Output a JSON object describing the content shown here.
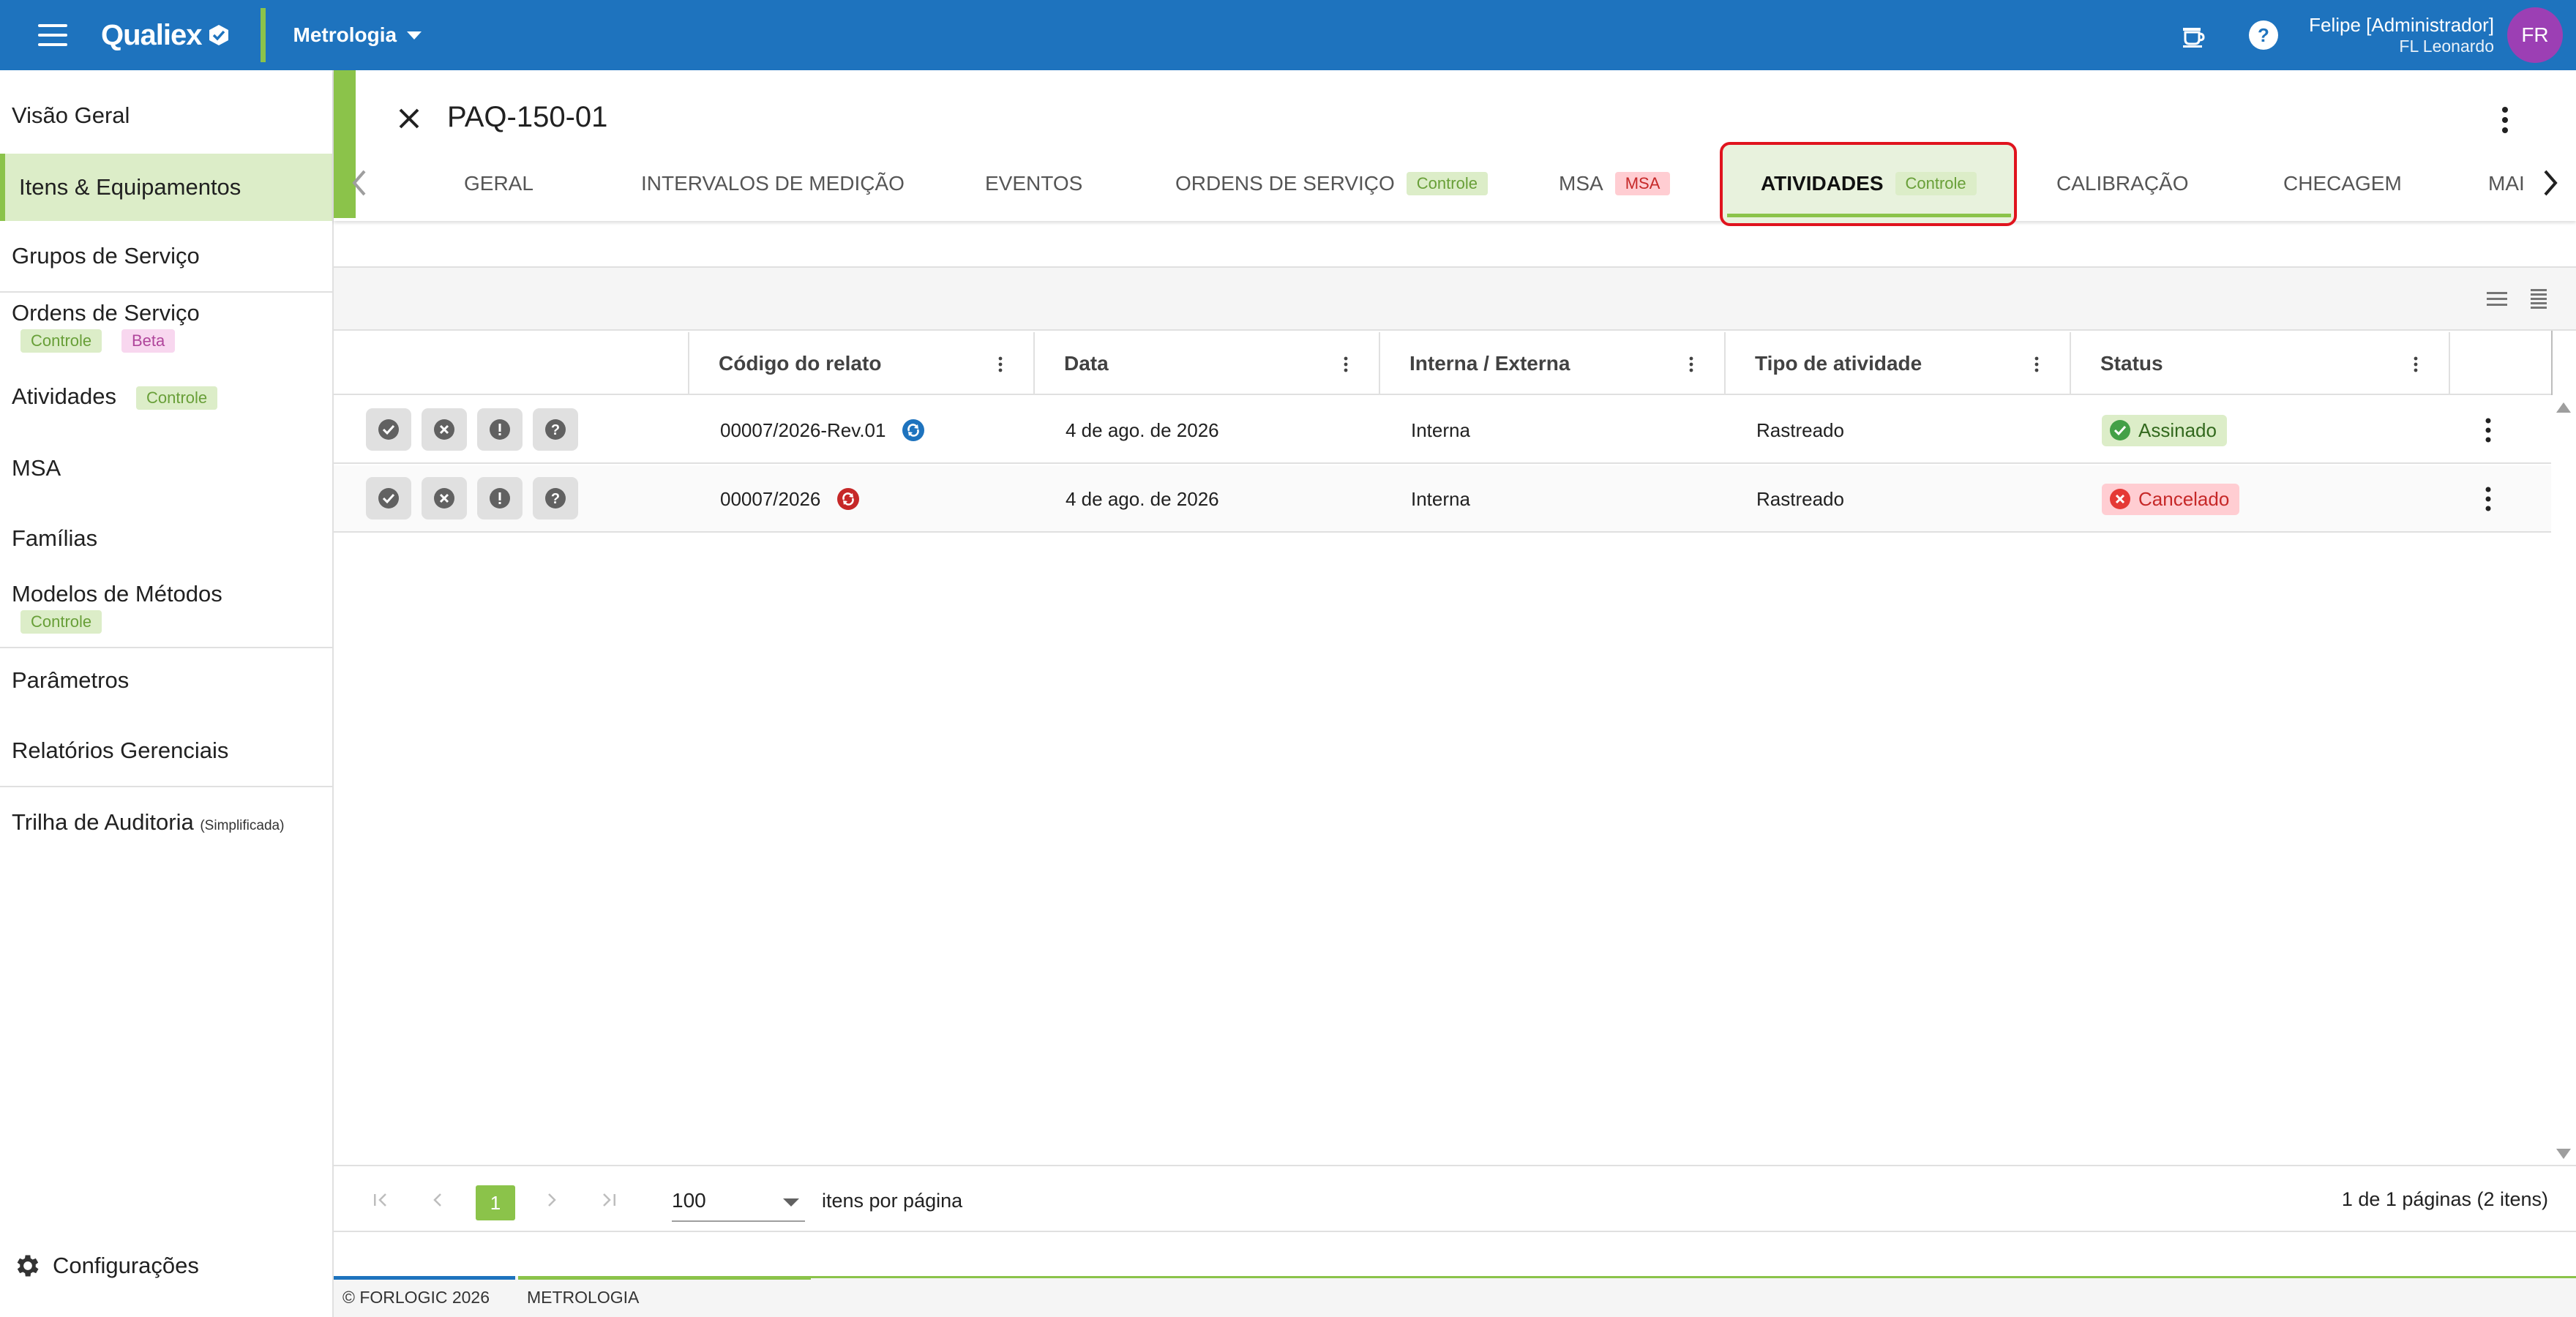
{
  "topbar": {
    "logo": "Qualiex",
    "module": "Metrologia",
    "user_name": "Felipe [Administrador]",
    "user_company": "FL Leonardo",
    "avatar_initials": "FR",
    "color": "#1e73be"
  },
  "sidebar": {
    "items": [
      {
        "label": "Visão Geral"
      },
      {
        "label": "Itens & Equipamentos",
        "active": true
      },
      {
        "label": "Grupos de Serviço"
      },
      {
        "label": "Ordens de Serviço",
        "chips": [
          "Controle",
          "Beta"
        ]
      },
      {
        "label": "Atividades",
        "chips": [
          "Controle"
        ]
      },
      {
        "label": "MSA"
      },
      {
        "label": "Famílias"
      },
      {
        "label": "Modelos de Métodos",
        "chips": [
          "Controle"
        ]
      },
      {
        "label": "Parâmetros"
      },
      {
        "label": "Relatórios Gerenciais"
      },
      {
        "label": "Trilha de Auditoria",
        "suffix": "(Simplificada)"
      }
    ],
    "settings_label": "Configurações",
    "accent_color": "#8bc34a"
  },
  "header": {
    "title": "PAQ-150-01",
    "tabs": [
      {
        "label": "GERAL"
      },
      {
        "label": "INTERVALOS DE MEDIÇÃO"
      },
      {
        "label": "EVENTOS"
      },
      {
        "label": "ORDENS DE SERVIÇO",
        "chip": "Controle"
      },
      {
        "label": "MSA",
        "chip": "MSA"
      },
      {
        "label": "ATIVIDADES",
        "chip": "Controle",
        "active": true
      },
      {
        "label": "CALIBRAÇÃO"
      },
      {
        "label": "CHECAGEM"
      },
      {
        "label": "MAI"
      }
    ]
  },
  "table": {
    "columns": [
      "Código do relato",
      "Data",
      "Interna / Externa",
      "Tipo de atividade",
      "Status"
    ],
    "rows": [
      {
        "code": "00007/2026-Rev.01",
        "code_icon": "sync-blue-icon",
        "date": "4 de ago. de 2026",
        "scope": "Interna",
        "type": "Rastreado",
        "status": "Assinado",
        "status_color": "#33691e"
      },
      {
        "code": "00007/2026",
        "code_icon": "sync-red-icon",
        "date": "4 de ago. de 2026",
        "scope": "Interna",
        "type": "Rastreado",
        "status": "Cancelado",
        "status_color": "#c62828"
      }
    ]
  },
  "pagination": {
    "current_page": "1",
    "page_size": "100",
    "page_size_label": "itens por página",
    "summary": "1 de 1 páginas (2 itens)"
  },
  "footer": {
    "copyright": "© FORLOGIC 2026",
    "module": "METROLOGIA"
  }
}
